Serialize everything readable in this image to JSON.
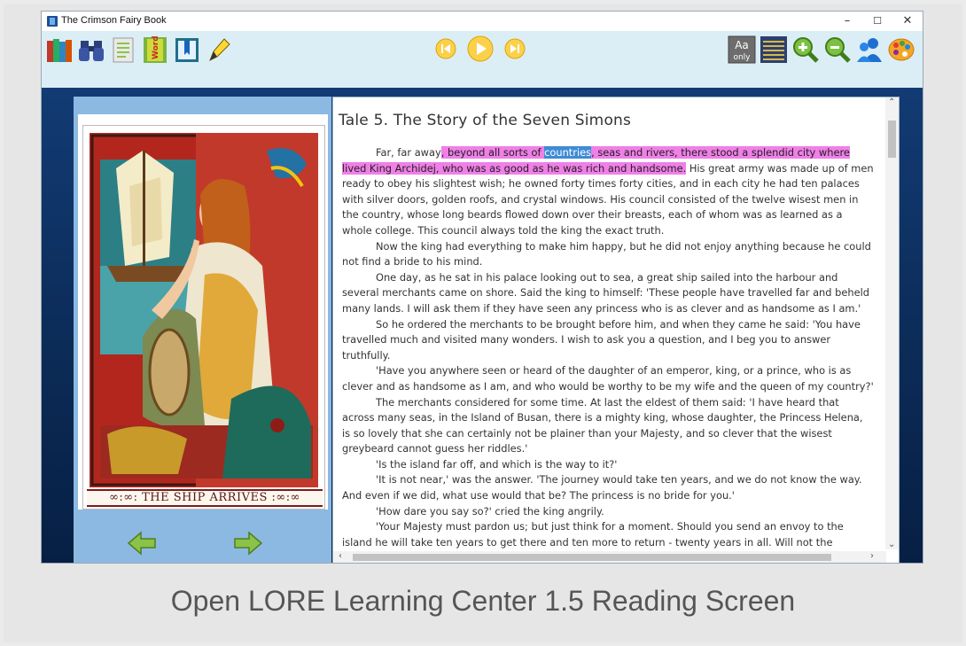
{
  "window": {
    "title": "The Crimson Fairy Book",
    "controls": [
      "–",
      "☐",
      "✕"
    ]
  },
  "toolbar": {
    "left_icons": [
      "library-icon",
      "binoculars-icon",
      "notes-icon",
      "word-list-icon",
      "bookmark-icon",
      "highlighter-icon"
    ],
    "word_label": "Word",
    "media_icons": [
      "previous-icon",
      "play-icon",
      "next-icon"
    ],
    "right_icons": [
      "font-only-icon",
      "lines-icon",
      "zoom-in-icon",
      "zoom-out-icon",
      "users-icon",
      "palette-icon"
    ],
    "aa_label": "Aa",
    "only_label": "only"
  },
  "illustration": {
    "caption": "∞:∞: THE SHIP ARRIVES :∞:∞"
  },
  "reader": {
    "tale_title": "Tale 5. The Story of the Seven Simons",
    "p1_start": "Far, far away",
    "p1_hl_a": ", beyond all sorts of ",
    "p1_hl_word": "countries",
    "p1_hl_b": ", seas and rivers, there stood a splendid city where lived King Archidej, who was as good as he was rich and handsome.",
    "p1_rest": " His great army was made up of men ready to obey his slightest wish; he owned forty times forty cities, and in each city he had ten palaces with silver doors, golden roofs, and crystal windows. His council consisted of the twelve wisest men in the country, whose long beards flowed down over their breasts, each of whom was as learned as a whole college. This council always told the king the exact truth.",
    "paragraphs": [
      "Now the king had everything to make him happy, but he did not enjoy anything because he could not find a bride to his mind.",
      "One day, as he sat in his palace looking out to sea, a great ship sailed into the harbour and several merchants came on shore. Said the king to himself: 'These people have travelled far and beheld many lands. I will ask them if they have seen any princess who is as clever and as handsome as I am.'",
      "So he ordered the merchants to be brought before him, and when they came he said: 'You have travelled much and visited many wonders. I wish to ask you a question, and I beg you to answer truthfully.",
      "'Have you anywhere seen or heard of the daughter of an emperor, king, or a prince, who is as clever and as handsome as I am, and who would be worthy to be my wife and the queen of my country?'",
      "The merchants considered for some time. At last the eldest of them said: 'I have heard that across many seas, in the Island of Busan, there is a mighty king, whose daughter, the Princess Helena, is so lovely that she can certainly not be plainer than your Majesty, and so clever that the wisest greybeard cannot guess her riddles.'",
      "'Is the island far off, and which is the way to it?'",
      "'It is not near,' was the answer. 'The journey would take ten years, and we do not know the way. And even if we did, what use would that be? The princess is no bride for you.'",
      "'How dare you say so?' cried the king angrily.",
      "'Your Majesty must pardon us; but just think for a moment. Should you send an envoy to the island he will take ten years to get there and ten more to return - twenty years in all. Will not the"
    ]
  },
  "nav": {
    "prev_icon": "left-arrow-icon",
    "next_icon": "right-arrow-icon"
  },
  "caption": "Open LORE Learning Center 1.5 Reading Screen",
  "colors": {
    "toolbar_bg": "#dbeef6",
    "panel_blue": "#8cb9e2",
    "highlight_pink": "#f07fe7",
    "highlight_blue": "#3f8bd6"
  }
}
